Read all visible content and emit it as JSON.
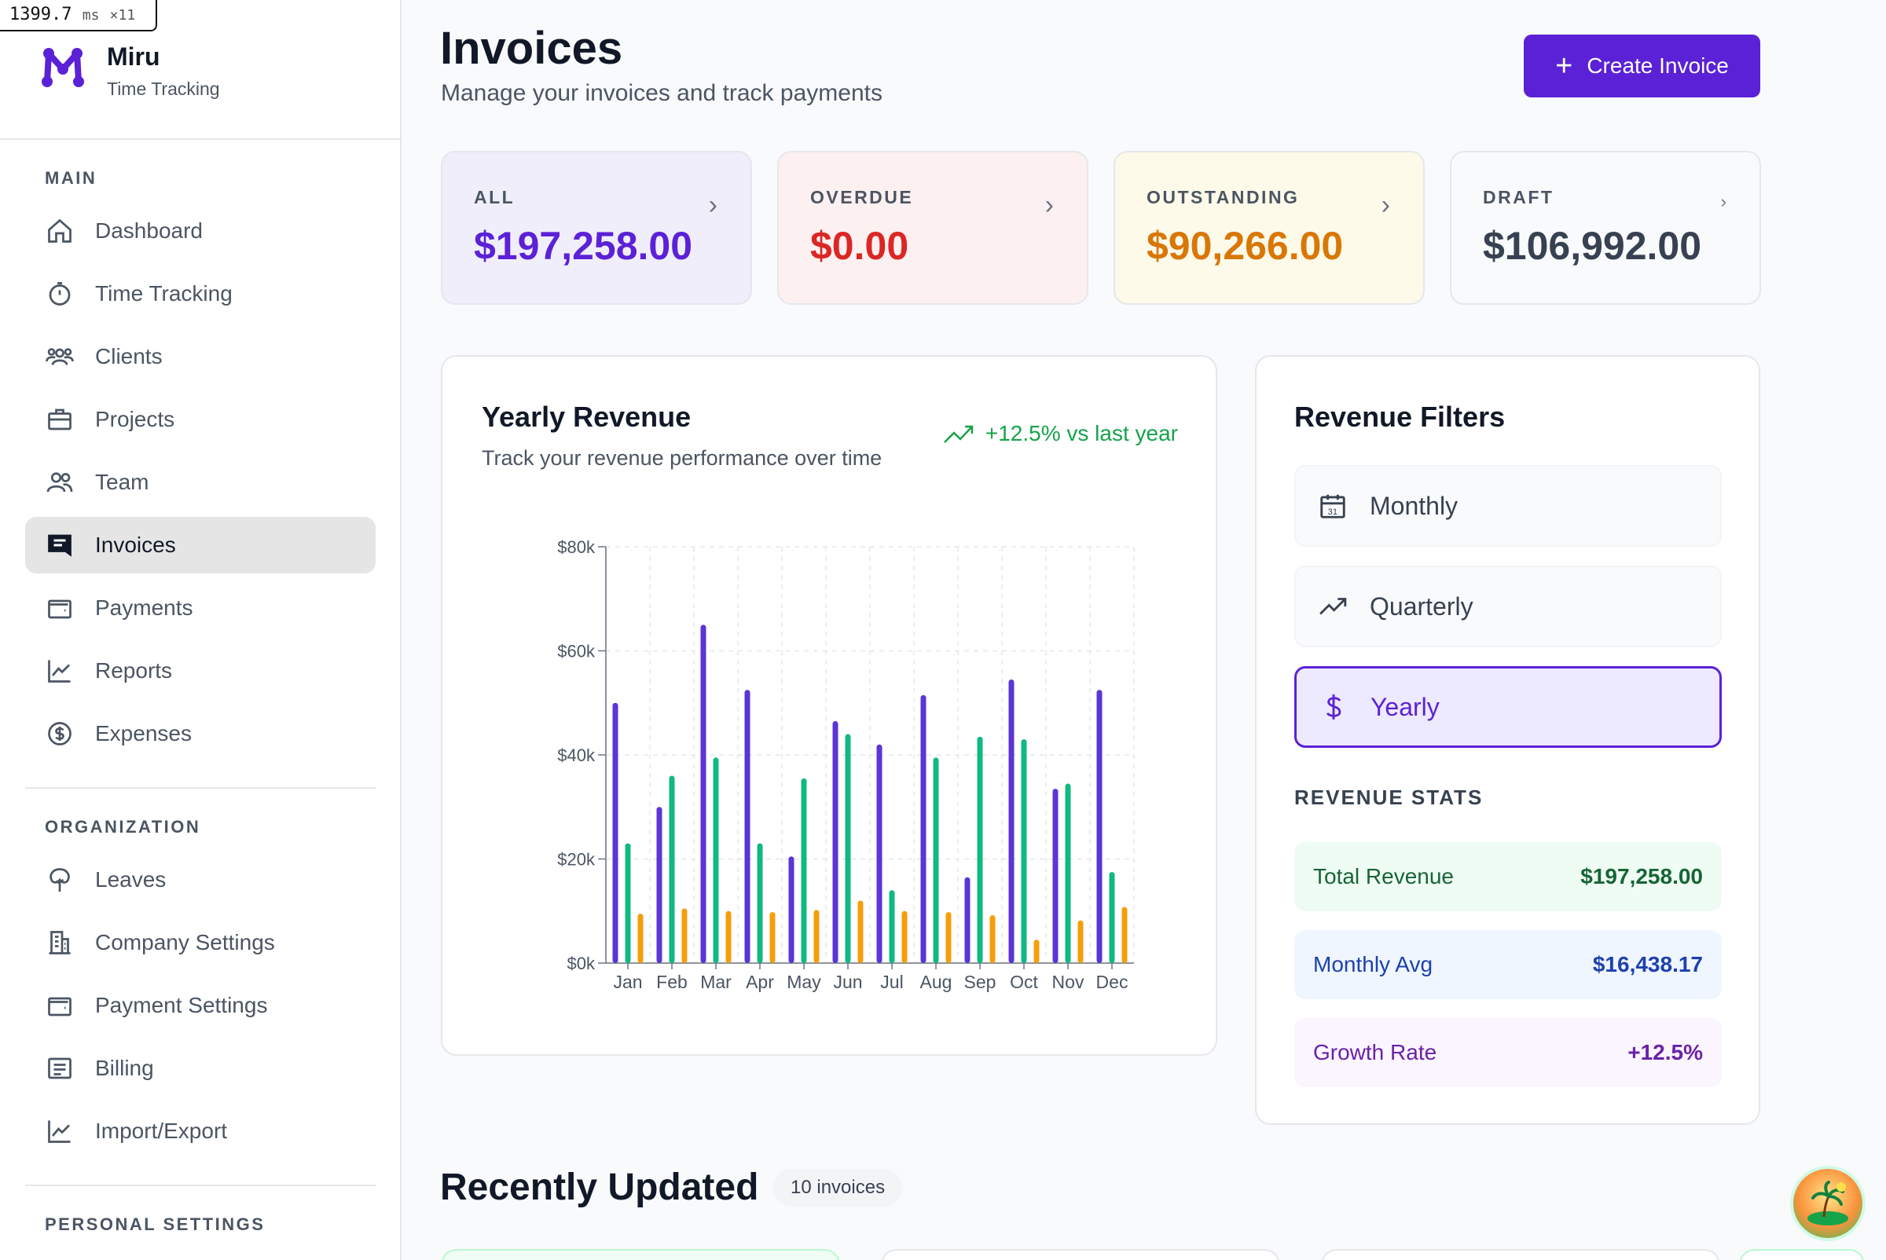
{
  "perf": {
    "value": "1399.7",
    "unit": "ms",
    "count": "×11"
  },
  "brand": {
    "name": "Miru",
    "subtitle": "Time Tracking"
  },
  "sidebar": {
    "main_title": "MAIN",
    "main_items": [
      {
        "label": "Dashboard",
        "icon": "home-icon"
      },
      {
        "label": "Time Tracking",
        "icon": "stopwatch-icon"
      },
      {
        "label": "Clients",
        "icon": "users-icon"
      },
      {
        "label": "Projects",
        "icon": "briefcase-icon"
      },
      {
        "label": "Team",
        "icon": "team-icon"
      },
      {
        "label": "Invoices",
        "icon": "invoice-icon",
        "active": true
      },
      {
        "label": "Payments",
        "icon": "wallet-icon"
      },
      {
        "label": "Reports",
        "icon": "chart-line-icon"
      },
      {
        "label": "Expenses",
        "icon": "dollar-circle-icon"
      }
    ],
    "org_title": "ORGANIZATION",
    "org_items": [
      {
        "label": "Leaves",
        "icon": "tree-icon"
      },
      {
        "label": "Company Settings",
        "icon": "building-icon"
      },
      {
        "label": "Payment Settings",
        "icon": "wallet-icon"
      },
      {
        "label": "Billing",
        "icon": "receipt-icon"
      },
      {
        "label": "Import/Export",
        "icon": "chart-line-icon"
      }
    ],
    "personal_title": "PERSONAL SETTINGS"
  },
  "header": {
    "title": "Invoices",
    "subtitle": "Manage your invoices and track payments",
    "create_label": "Create Invoice"
  },
  "stats": [
    {
      "label": "ALL",
      "value": "$197,258.00",
      "color": "#5b21d6",
      "bg": "#f0eefb"
    },
    {
      "label": "OVERDUE",
      "value": "$0.00",
      "color": "#dc2626",
      "bg": "#fdf0f0"
    },
    {
      "label": "OUTSTANDING",
      "value": "$90,266.00",
      "color": "#d97706",
      "bg": "#fdfaea"
    },
    {
      "label": "DRAFT",
      "value": "$106,992.00",
      "color": "#374151",
      "bg": "#f9fafb"
    }
  ],
  "revenue": {
    "title": "Yearly Revenue",
    "subtitle": "Track your revenue performance over time",
    "growth": "+12.5% vs last year"
  },
  "chart_data": {
    "type": "bar",
    "categories": [
      "Jan",
      "Feb",
      "Mar",
      "Apr",
      "May",
      "Jun",
      "Jul",
      "Aug",
      "Sep",
      "Oct",
      "Nov",
      "Dec"
    ],
    "series": [
      {
        "color": "#5b35d5",
        "values": [
          50000,
          30000,
          65000,
          52500,
          20500,
          46500,
          42000,
          51500,
          16500,
          54500,
          33500,
          52500
        ]
      },
      {
        "color": "#10b981",
        "values": [
          23000,
          36000,
          39500,
          23000,
          35500,
          44000,
          14000,
          39500,
          43500,
          43000,
          34500,
          17500
        ]
      },
      {
        "color": "#f59e0b",
        "values": [
          9500,
          10500,
          10000,
          9800,
          10200,
          12000,
          10000,
          9800,
          9200,
          4500,
          8200,
          10800
        ]
      }
    ],
    "ylim": [
      0,
      80000
    ],
    "yticks": [
      "$0k",
      "$20k",
      "$40k",
      "$60k",
      "$80k"
    ],
    "grid": true
  },
  "filters": {
    "title": "Revenue Filters",
    "options": [
      {
        "label": "Monthly",
        "icon": "calendar-icon"
      },
      {
        "label": "Quarterly",
        "icon": "trending-up-icon"
      },
      {
        "label": "Yearly",
        "icon": "dollar-icon",
        "active": true
      }
    ],
    "stats_title": "REVENUE STATS",
    "stats": [
      {
        "label": "Total Revenue",
        "value": "$197,258.00",
        "bg": "#effcf4",
        "color": "#166534"
      },
      {
        "label": "Monthly Avg",
        "value": "$16,438.17",
        "bg": "#eff6ff",
        "color": "#1e40af"
      },
      {
        "label": "Growth Rate",
        "value": "+12.5%",
        "bg": "#faf5ff",
        "color": "#6b21a8"
      }
    ]
  },
  "recent": {
    "title": "Recently Updated",
    "badge": "10 invoices"
  }
}
